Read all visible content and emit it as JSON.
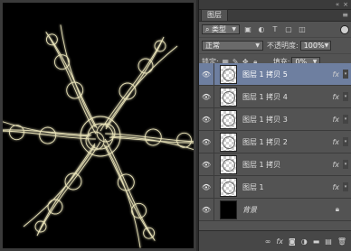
{
  "panel": {
    "tab_label": "图层",
    "menu_icon": "panel-menu-icon",
    "filter": {
      "value": "类型",
      "icons": [
        "image-filter-icon",
        "adjustment-filter-icon",
        "type-filter-icon",
        "shape-filter-icon",
        "smart-object-filter-icon"
      ]
    },
    "blend_mode": "正常",
    "opacity_label": "不透明度:",
    "opacity_value": "100%",
    "lock_label": "锁定:",
    "fill_label": "填充:",
    "fill_value": "0%"
  },
  "layers": [
    {
      "name": "图层 1 拷贝 5",
      "selected": true,
      "fx": "fx",
      "visible": true
    },
    {
      "name": "图层 1 拷贝 4",
      "selected": false,
      "fx": "fx",
      "visible": true
    },
    {
      "name": "图层 1 拷贝 3",
      "selected": false,
      "fx": "fx",
      "visible": true
    },
    {
      "name": "图层 1 拷贝 2",
      "selected": false,
      "fx": "fx",
      "visible": true
    },
    {
      "name": "图层 1 拷贝",
      "selected": false,
      "fx": "fx",
      "visible": true
    },
    {
      "name": "图层 1",
      "selected": false,
      "fx": "fx",
      "visible": true
    },
    {
      "name": "背景",
      "selected": false,
      "fx": "",
      "visible": true,
      "background": true
    }
  ],
  "bottom_icons": [
    "link-layers-icon",
    "fx-icon",
    "add-mask-icon",
    "adjustment-layer-icon",
    "new-group-icon",
    "new-layer-icon",
    "delete-layer-icon"
  ],
  "colors": {
    "selected_row": "#6e7fa0",
    "panel_bg": "#535353",
    "glow": "#e8e2b8"
  }
}
